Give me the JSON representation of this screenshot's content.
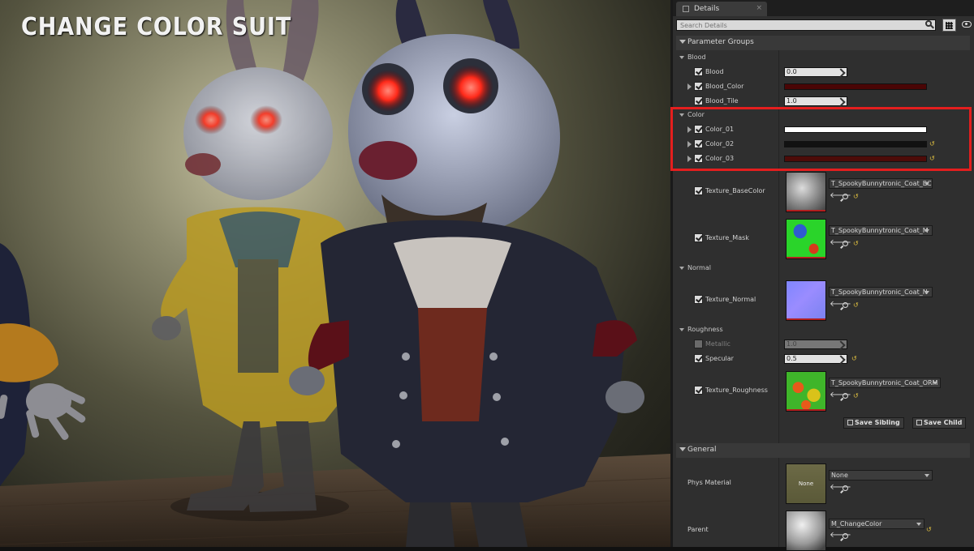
{
  "viewport": {
    "overlay_title": "CHANGE COLOR SUIT"
  },
  "panel": {
    "tab_title": "Details",
    "search_placeholder": "Search Details",
    "parameter_groups_label": "Parameter Groups",
    "blood": {
      "label": "Blood",
      "params": {
        "blood": {
          "label": "Blood",
          "value": "0.0"
        },
        "blood_color": {
          "label": "Blood_Color",
          "color": "#4a0505"
        },
        "blood_tile": {
          "label": "Blood_Tile",
          "value": "1.0"
        }
      }
    },
    "color": {
      "label": "Color",
      "params": [
        {
          "label": "Color_01",
          "color": "#ffffff"
        },
        {
          "label": "Color_02",
          "color": "#111111"
        },
        {
          "label": "Color_03",
          "color": "#4d0b08"
        }
      ]
    },
    "texture_base_color": {
      "label": "Texture_BaseColor",
      "asset": "T_SpookyBunnytronic_Coat_BC"
    },
    "texture_mask": {
      "label": "Texture_Mask",
      "asset": "T_SpookyBunnytronic_Coat_M"
    },
    "normal": {
      "label": "Normal",
      "texture_normal": {
        "label": "Texture_Normal",
        "asset": "T_SpookyBunnytronic_Coat_N"
      }
    },
    "roughness": {
      "label": "Roughness",
      "metallic": {
        "label": "Metallic",
        "value": "1.0"
      },
      "specular": {
        "label": "Specular",
        "value": "0.5"
      },
      "texture_roughness": {
        "label": "Texture_Roughness",
        "asset": "T_SpookyBunnytronic_Coat_ORM"
      }
    },
    "save_sibling_label": "Save Sibling",
    "save_child_label": "Save Child",
    "general": {
      "label": "General",
      "phys_material": {
        "label": "Phys Material",
        "thumb_text": "None",
        "asset": "None"
      },
      "parent": {
        "label": "Parent",
        "asset": "M_ChangeColor"
      }
    }
  },
  "colors": {
    "highlight": "#e41e1e",
    "reset_arrow": "#e0c040"
  }
}
